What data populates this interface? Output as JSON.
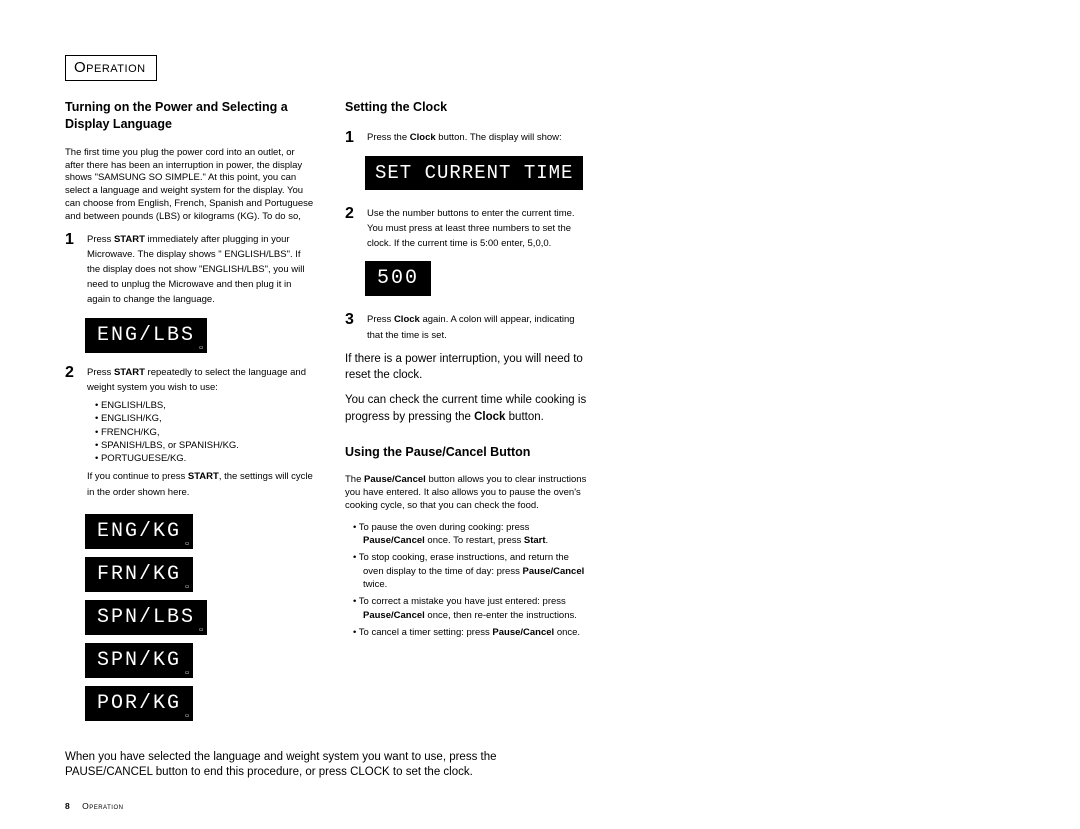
{
  "section_title": "Operation",
  "left": {
    "heading": "Turning on the Power and Selecting a Display Language",
    "intro": "The first time you plug the power cord into an outlet, or after there has been an interruption in power, the display shows \"SAMSUNG SO SIMPLE.\" At this point, you can select a language and weight system for the display. You can choose from English, French, Spanish and Portuguese and between pounds (LBS) or kilograms (KG). To do so,",
    "step1_a": "Press ",
    "step1_b": "START",
    "step1_c": " immediately after plugging in your Microwave. The display shows \" ENGLISH/LBS\". If the display does not show \"ENGLISH/LBS\", you will need to unplug the Microwave and then plug it in again to change the language.",
    "lcd1": "ENG/LBS",
    "step2_a": "Press ",
    "step2_b": "START",
    "step2_c": " repeatedly to select the language and weight system you wish to use:",
    "opts": [
      "ENGLISH/LBS,",
      "ENGLISH/KG,",
      "FRENCH/KG,",
      "SPANISH/LBS, or  SPANISH/KG.",
      "PORTUGUESE/KG."
    ],
    "step2_d": "If you continue to press ",
    "step2_e": "START",
    "step2_f": ", the settings will cycle in the order shown here.",
    "lcds": [
      "ENG/KG",
      "FRN/KG",
      "SPN/LBS",
      "SPN/KG",
      "POR/KG"
    ],
    "bottom": "When you have selected the language and weight system you want to use, press the PAUSE/CANCEL button to end this procedure, or press CLOCK to set the clock."
  },
  "right": {
    "clock_heading": "Setting the Clock",
    "c1_a": "Press the ",
    "c1_b": "Clock",
    "c1_c": " button.  The display will show:",
    "lcd_time": "SET CURRENT TIME",
    "c2": "Use the number buttons to enter the current time. You must press at least three numbers to set the clock. If the current time is 5:00 enter, 5,0,0.",
    "lcd_500": "500",
    "c3_a": "Press ",
    "c3_b": "Clock",
    "c3_c": " again. A colon will appear, indicating that the time is set.",
    "note1": "If there is a power interruption, you will need to reset the clock.",
    "note2_a": "You can check the current time while cooking is progress by pressing the ",
    "note2_b": "Clock",
    "note2_c": " button.",
    "pause_heading": "Using the Pause/Cancel Button",
    "p_intro_a": "The ",
    "p_intro_b": "Pause/Cancel",
    "p_intro_c": " button allows you to clear instructions you have entered. It also allows you to pause the oven's cooking cycle, so that you can check the food.",
    "pb1_a": "To pause the oven during cooking: press ",
    "pb1_b": "Pause/Cancel",
    "pb1_c": " once.  To restart, press ",
    "pb1_d": "Start",
    "pb1_e": ".",
    "pb2_a": "To stop cooking, erase instructions, and return the oven display to the time of day: press ",
    "pb2_b": "Pause/Cancel",
    "pb2_c": " twice.",
    "pb3_a": "To correct a mistake you have just entered: press ",
    "pb3_b": "Pause/Cancel",
    "pb3_c": " once, then re-enter the instructions.",
    "pb4_a": "To cancel a timer setting: press ",
    "pb4_b": "Pause/Cancel",
    "pb4_c": " once."
  },
  "footer_page": "8",
  "footer_sec": "Operation"
}
